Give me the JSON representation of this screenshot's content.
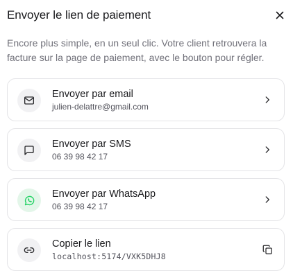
{
  "dialog": {
    "title": "Envoyer le lien de paiement",
    "description": "Encore plus simple, en un seul clic. Votre client retrouvera la facture sur la page de paiement, avec le bouton pour régler."
  },
  "options": [
    {
      "title": "Envoyer par email",
      "subtitle": "julien-delattre@gmail.com",
      "icon": "mail-icon",
      "action_icon": "chevron-right-icon"
    },
    {
      "title": "Envoyer par SMS",
      "subtitle": "06 39 98 42 17",
      "icon": "message-square-icon",
      "action_icon": "chevron-right-icon"
    },
    {
      "title": "Envoyer par WhatsApp",
      "subtitle": "06 39 98 42 17",
      "icon": "whatsapp-icon",
      "action_icon": "chevron-right-icon"
    },
    {
      "title": "Copier le lien",
      "subtitle": "localhost:5174/VXK5DHJ8",
      "icon": "link-icon",
      "action_icon": "copy-icon"
    }
  ],
  "colors": {
    "text": "#18181b",
    "muted": "#71717a",
    "border": "#e4e4e7",
    "icon_bg": "#f1f1f3",
    "whatsapp": "#25d366"
  }
}
